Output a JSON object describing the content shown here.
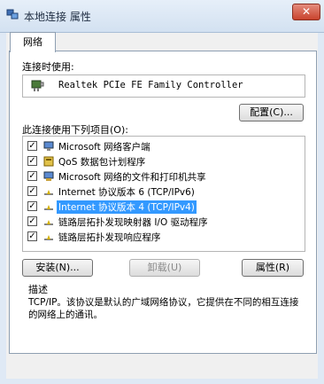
{
  "window": {
    "title": "本地连接 属性",
    "close_label": "✕",
    "colors": {
      "titlebar": "#dfe9f5",
      "close": "#c9432d",
      "selection": "#3399ff"
    }
  },
  "tabs": [
    {
      "label": "网络"
    }
  ],
  "connect_using": {
    "label": "连接时使用:",
    "device": "Realtek PCIe FE Family Controller",
    "device_icon": "network-adapter-icon",
    "configure_button": "配置(C)..."
  },
  "items_section": {
    "label": "此连接使用下列项目(O):",
    "items": [
      {
        "label": "Microsoft 网络客户端",
        "checked": true,
        "icon": "network-client-icon"
      },
      {
        "label": "QoS 数据包计划程序",
        "checked": true,
        "icon": "qos-icon"
      },
      {
        "label": "Microsoft 网络的文件和打印机共享",
        "checked": true,
        "icon": "file-sharing-icon"
      },
      {
        "label": "Internet 协议版本 6 (TCP/IPv6)",
        "checked": true,
        "icon": "protocol-icon"
      },
      {
        "label": "Internet 协议版本 4 (TCP/IPv4)",
        "checked": true,
        "icon": "protocol-icon",
        "selected": true
      },
      {
        "label": "链路层拓扑发现映射器 I/O 驱动程序",
        "checked": true,
        "icon": "protocol-icon"
      },
      {
        "label": "链路层拓扑发现响应程序",
        "checked": true,
        "icon": "protocol-icon"
      }
    ]
  },
  "buttons": {
    "install": "安装(N)...",
    "uninstall": "卸载(U)",
    "properties": "属性(R)"
  },
  "description": {
    "label": "描述",
    "text": "TCP/IP。该协议是默认的广域网络协议，它提供在不同的相互连接的网络上的通讯。"
  }
}
